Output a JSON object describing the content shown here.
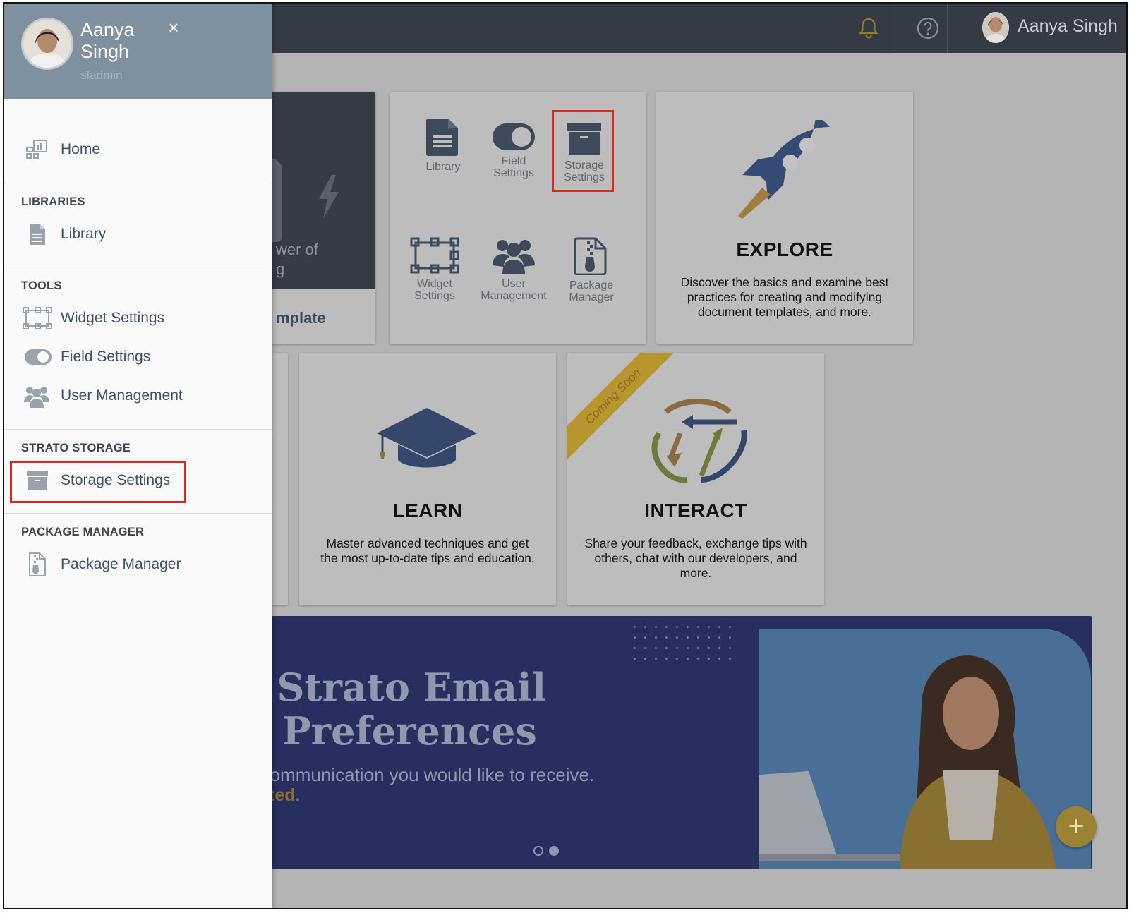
{
  "topbar": {
    "user_name": "Aanya Singh",
    "icons": [
      "bell-icon",
      "help-icon"
    ]
  },
  "drawer": {
    "user_name": "Aanya Singh",
    "user_role": "sfadmin",
    "close": "×",
    "home": "Home",
    "sections": {
      "libraries": "LIBRARIES",
      "tools": "TOOLS",
      "strato_storage": "STRATO STORAGE",
      "package_manager": "PACKAGE MANAGER"
    },
    "items": {
      "library": "Library",
      "widget_settings": "Widget Settings",
      "field_settings": "Field Settings",
      "user_management": "User Management",
      "storage_settings": "Storage Settings",
      "package_manager": "Package Manager"
    }
  },
  "main": {
    "template_card": {
      "text_fragment": "wer of\ng",
      "cta_fragment": "mplate"
    },
    "tools_card": {
      "library": "Library",
      "field_settings": "Field\nSettings",
      "storage_settings": "Storage\nSettings",
      "widget_settings": "Widget\nSettings",
      "user_management": "User\nManagement",
      "package_manager": "Package\nManager"
    },
    "explore": {
      "title": "EXPLORE",
      "desc": "Discover the basics and examine best practices for creating and modifying document templates, and more."
    },
    "learn": {
      "title": "LEARN",
      "desc": "Master advanced techniques and get the most up-to-date tips and education."
    },
    "interact": {
      "ribbon": "Coming Soon",
      "title": "INTERACT",
      "desc": "Share your feedback, exchange tips with others, chat with our developers, and more."
    },
    "banner": {
      "line1": "ur Strato Email",
      "line2": "on Preferences",
      "sub": "es of communication you would like to receive.",
      "cta": "et started."
    },
    "fab": "+"
  },
  "colors": {
    "highlight": "#e0251b",
    "topbar": "#353b45",
    "drawer_header": "#7f919f",
    "nav_text": "#3e5167"
  }
}
